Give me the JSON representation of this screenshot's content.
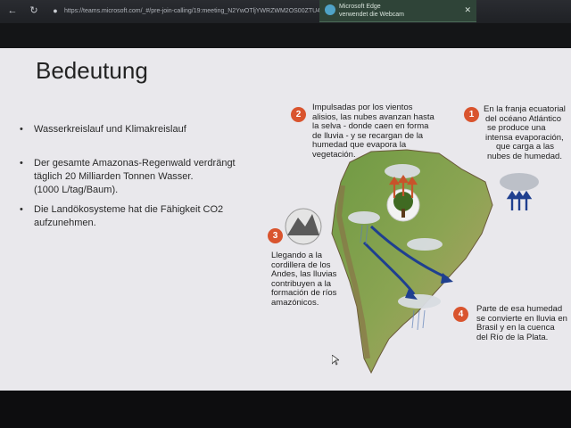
{
  "browser": {
    "address": "https://teams.microsoft.com/_#/pre-join-calling/19:meeting_N2YwOTljYWRZWM2OS00ZTU4",
    "nav_icons": [
      "back-icon",
      "refresh-icon",
      "lock-icon"
    ]
  },
  "toast": {
    "app": "Microsoft Edge",
    "message": "verwendet die Webcam",
    "icon": "webcam-icon"
  },
  "slide": {
    "title": "Bedeutung",
    "bullet_symbol": "•",
    "bullets": [
      {
        "lines": [
          "Wasserkreislauf und Klimakreislauf"
        ]
      },
      {
        "lines": [
          " Der gesamte Amazonas-Regenwald verdrängt",
          "täglich 20 Milliarden Tonnen Wasser.",
          "(1000 L/tag/Baum)."
        ]
      },
      {
        "lines": [
          "Die Landökosysteme hat die Fähigkeit  CO2",
          "aufzunehmen."
        ]
      }
    ]
  },
  "infographic": {
    "steps": [
      {
        "number": "1",
        "lines": [
          "En la franja ecuatorial",
          "del océano Atlántico",
          "se produce una",
          "intensa evaporación,",
          "que carga a las",
          "nubes de humedad."
        ]
      },
      {
        "number": "2",
        "lines": [
          "Impulsadas por los vientos",
          "alisios, las nubes avanzan hasta",
          "la selva - donde caen en forma",
          "de lluvia - y se recargan de la",
          "humedad que evapora la",
          "vegetación."
        ]
      },
      {
        "number": "3",
        "lines": [
          "Llegando a la",
          "cordillera de los",
          "Andes, las lluvias",
          "contribuyen a la",
          "formación de ríos",
          "amazónicos."
        ]
      },
      {
        "number": "4",
        "lines": [
          "Parte de esa humedad",
          "se convierte en lluvia en",
          "Brasil y en la cuenca",
          "del Río de la Plata."
        ]
      }
    ],
    "colors": {
      "step_badge": "#d9542e",
      "ocean_arrow": "#1f3f8f",
      "land": "#5f8a3a"
    }
  }
}
